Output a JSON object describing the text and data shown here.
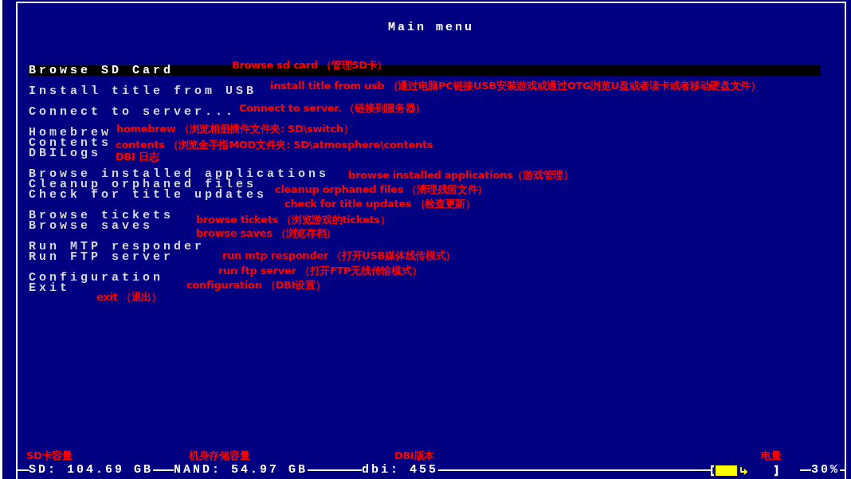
{
  "window": {
    "title": "Main menu"
  },
  "menu": {
    "groups": [
      {
        "items": [
          {
            "label": "Browse SD Card",
            "selected": true,
            "note": "Browse sd card （管理SD卡）"
          }
        ]
      },
      {
        "items": [
          {
            "label": "Install title from USB",
            "selected": false,
            "note": "install title from usb （通过电脑PC链接USB安装游戏或通过OTG浏览U盘或者读卡或者移动硬盘文件）"
          }
        ]
      },
      {
        "items": [
          {
            "label": "Connect to server...",
            "selected": false,
            "note": "Connect to server. （链接到服务器）"
          }
        ]
      },
      {
        "items": [
          {
            "label": "Homebrew",
            "selected": false,
            "note": "homebrew （浏览相册插件文件夹: SD\\switch）"
          },
          {
            "label": "Contents",
            "selected": false,
            "note": "contents （浏览金手指MOD文件夹: SD\\atmosphere\\contents"
          },
          {
            "label": "DBILogs",
            "selected": false,
            "note": "DBI 日志"
          }
        ]
      },
      {
        "items": [
          {
            "label": "Browse installed applications",
            "selected": false,
            "note": "browse installed applications（游戏管理）"
          },
          {
            "label": "Cleanup orphaned files",
            "selected": false,
            "note": "cleanup orphaned files （清理残留文件）"
          },
          {
            "label": "Check for title updates",
            "selected": false,
            "note": "check for title updates （检查更新）"
          }
        ]
      },
      {
        "items": [
          {
            "label": "Browse tickets",
            "selected": false,
            "note": "browse tickets （浏览游戏的tickets）"
          },
          {
            "label": "Browse saves",
            "selected": false,
            "note": "browse saves （浏览存档）"
          }
        ]
      },
      {
        "items": [
          {
            "label": "Run MTP responder",
            "selected": false,
            "note": "run mtp responder （打开USB媒体线传模式）"
          },
          {
            "label": "Run FTP server",
            "selected": false,
            "note": "run ftp server （打开FTP无线传输模式）"
          }
        ]
      },
      {
        "items": [
          {
            "label": "Configuration",
            "selected": false,
            "note": "configuration （DBI设置）"
          },
          {
            "label": "Exit",
            "selected": false,
            "note": "exit （退出）"
          }
        ]
      }
    ]
  },
  "status_bar": {
    "sd": "SD: 104.69 GB",
    "nand": "NAND: 54.97 GB",
    "version": "dbi: 455",
    "battery": "30%"
  },
  "footer_notes": [
    "SD卡容量",
    "机身存储容量",
    "DBI版本",
    "电量"
  ]
}
